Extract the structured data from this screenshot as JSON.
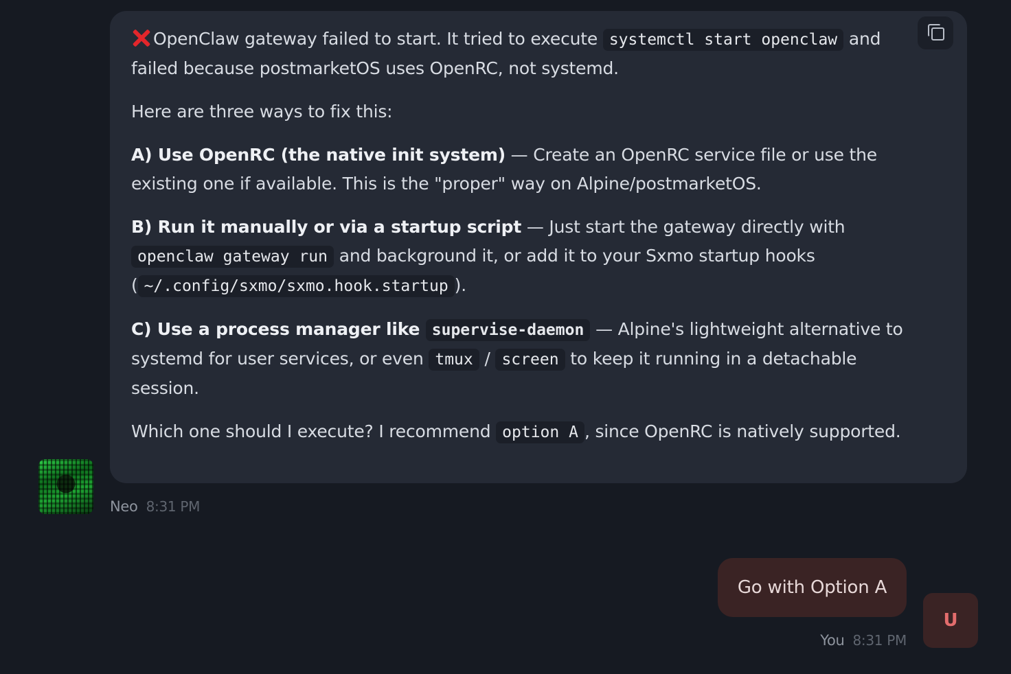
{
  "assistant": {
    "name": "Neo",
    "time": "8:31 PM",
    "status_icon": "red-x-icon",
    "p1": {
      "t1": "OpenClaw gateway failed to start. It tried to execute ",
      "code1": "systemctl start openclaw",
      "t2": " and failed because postmarketOS uses OpenRC, not systemd."
    },
    "p2": "Here are three ways to fix this:",
    "optA": {
      "title": "A) Use OpenRC (the native init system)",
      "text": " — Create an OpenRC service file or use the existing one if available. This is the \"proper\" way on Alpine/postmarketOS."
    },
    "optB": {
      "title": "B) Run it manually or via a startup script",
      "t1": " — Just start the gateway directly with ",
      "code1": "openclaw gateway run",
      "t2": " and background it, or add it to your Sxmo startup hooks (",
      "code2": "~/.config/sxmo/sxmo.hook.startup",
      "t3": ")."
    },
    "optC": {
      "title": "C) Use a process manager like ",
      "code1": "supervise-daemon",
      "t1": " — Alpine's lightweight alternative to systemd for user services, or even ",
      "code2": "tmux",
      "t2": " / ",
      "code3": "screen",
      "t3": " to keep it running in a detachable session."
    },
    "p_last": {
      "t1": "Which one should I execute? I recommend ",
      "code1": "option A",
      "t2": ", since OpenRC is natively supported."
    }
  },
  "user": {
    "message": "Go with Option A",
    "name": "You",
    "time": "8:31 PM",
    "avatar_letter": "U"
  },
  "colors": {
    "background": "#161a22",
    "assistant_bubble": "#252a35",
    "user_bubble": "#3a2324",
    "user_avatar_letter": "#e36d6d",
    "error_icon": "#e3262b"
  }
}
